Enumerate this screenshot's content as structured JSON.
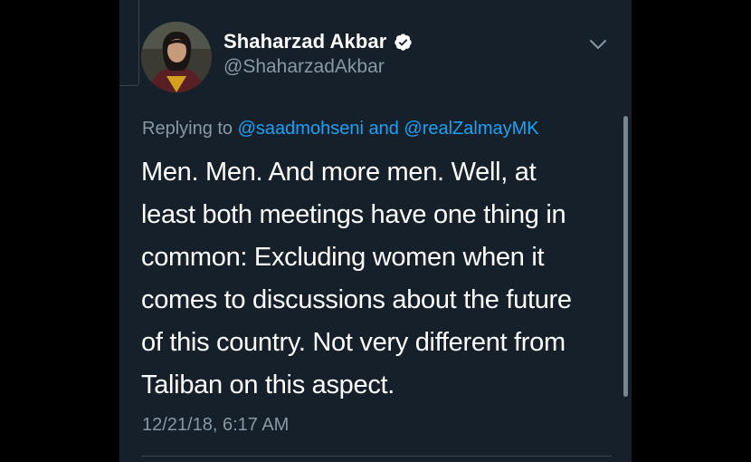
{
  "tweet": {
    "display_name": "Shaharzad Akbar",
    "handle": "@ShaharzadAkbar",
    "verified": true,
    "reply": {
      "prefix": "Replying to",
      "mention_1": "@saadmohseni",
      "conjunction": "and",
      "mention_2": "@realZalmayMK"
    },
    "text_lines": [
      "Men. Men. And more men. Well, at",
      "least both meetings have one thing in",
      "common: Excluding women when it",
      "comes to discussions about the future",
      "of this country. Not very different from",
      "Taliban on this aspect."
    ],
    "timestamp": "12/21/18, 6:17 AM"
  },
  "icons": {
    "verified": "verified-badge-icon",
    "menu": "chevron-down-icon"
  },
  "colors": {
    "background": "#15202b",
    "text": "#ffffff",
    "secondary": "#8899a6",
    "link": "#1da1f2",
    "verified_badge": "#ffffff"
  }
}
